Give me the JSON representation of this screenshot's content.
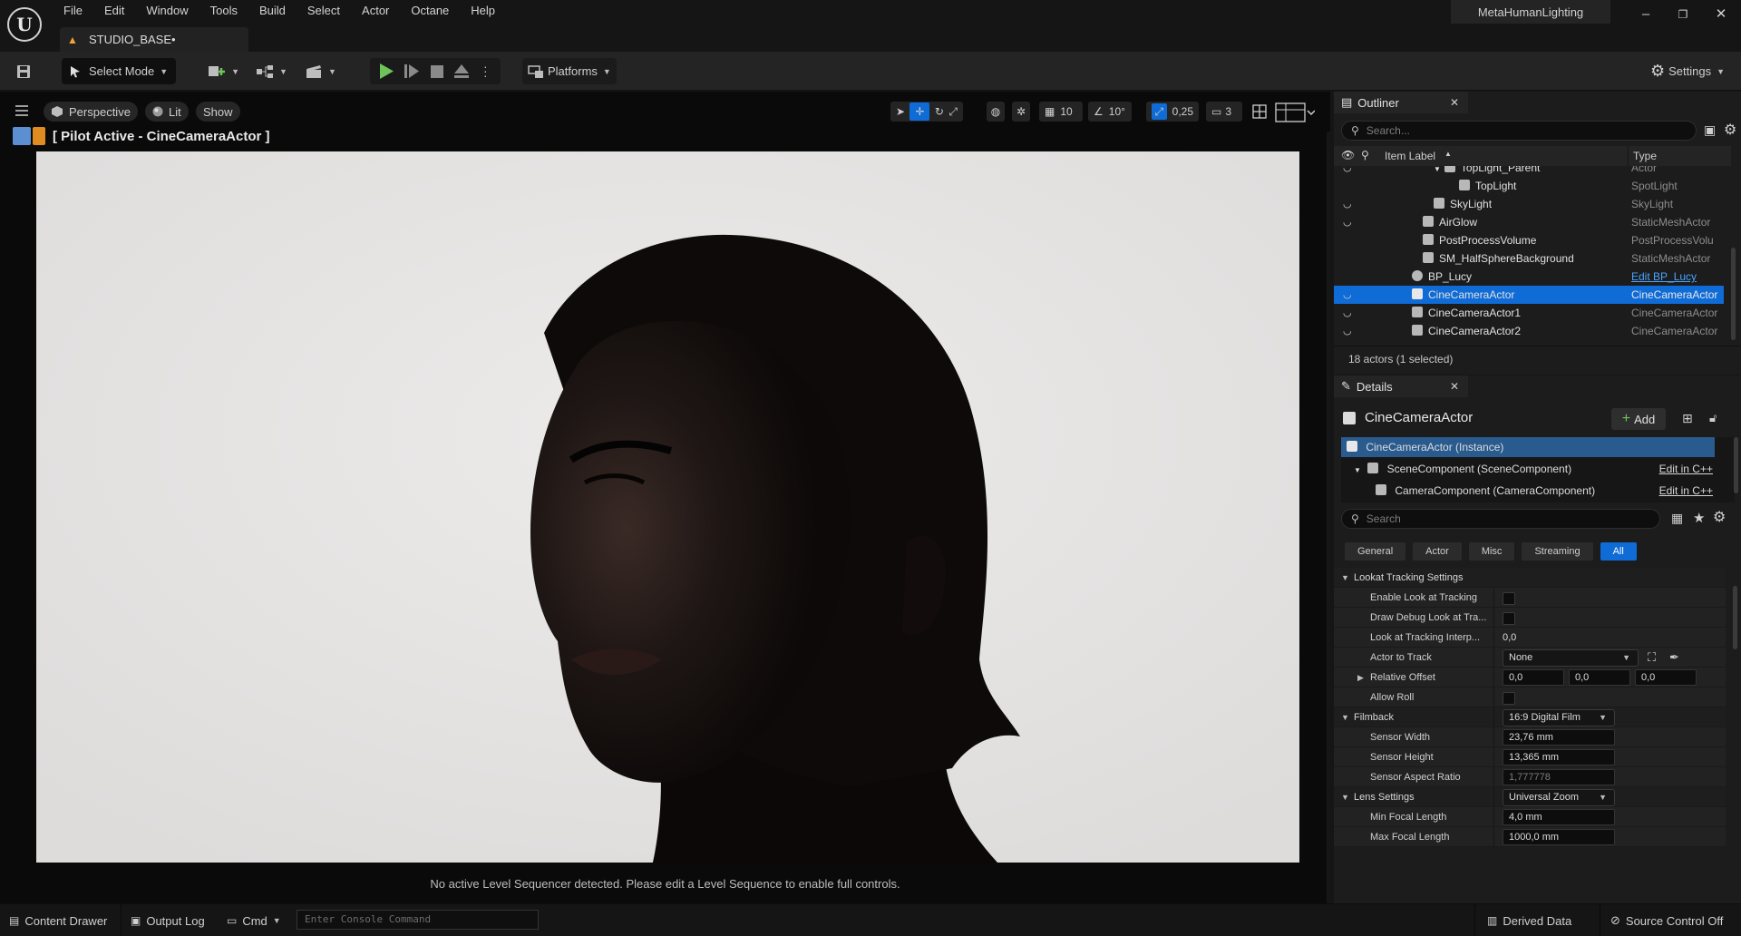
{
  "app": {
    "logo_label": "U",
    "menu": [
      "File",
      "Edit",
      "Window",
      "Tools",
      "Build",
      "Select",
      "Actor",
      "Octane",
      "Help"
    ],
    "document_tab": "STUDIO_BASE•",
    "project_name": "MetaHumanLighting",
    "window_controls": {
      "minimize": "–",
      "restore": "❐",
      "close": "✕"
    }
  },
  "toolbar": {
    "select_mode": "Select Mode",
    "platforms": "Platforms",
    "settings": "Settings"
  },
  "viewport": {
    "perspective": "Perspective",
    "lit": "Lit",
    "show": "Show",
    "grid_snap": "10",
    "rotation_snap": "10°",
    "scale_snap": "0,25",
    "camera_speed": "3",
    "pilot_label": "[ Pilot Active - CineCameraActor ]",
    "status_message": "No active Level Sequencer detected. Please edit a Level Sequence to enable full controls."
  },
  "outliner": {
    "tab_label": "Outliner",
    "search_placeholder": "Search...",
    "col_label": "Item Label",
    "col_type": "Type",
    "rows": [
      {
        "label": "TopLight_Parent",
        "type": "Actor"
      },
      {
        "label": "TopLight",
        "type": "SpotLight"
      },
      {
        "label": "SkyLight",
        "type": "SkyLight"
      },
      {
        "label": "AirGlow",
        "type": "StaticMeshActor"
      },
      {
        "label": "PostProcessVolume",
        "type": "PostProcessVolu"
      },
      {
        "label": "SM_HalfSphereBackground",
        "type": "StaticMeshActor"
      },
      {
        "label": "BP_Lucy",
        "type": "Edit BP_Lucy"
      },
      {
        "label": "CineCameraActor",
        "type": "CineCameraActor"
      },
      {
        "label": "CineCameraActor1",
        "type": "CineCameraActor"
      },
      {
        "label": "CineCameraActor2",
        "type": "CineCameraActor"
      }
    ],
    "actor_count": "18 actors (1 selected)"
  },
  "details": {
    "tab_label": "Details",
    "actor_name": "CineCameraActor",
    "add_label": "Add",
    "components": [
      {
        "label": "CineCameraActor (Instance)",
        "edit": ""
      },
      {
        "label": "SceneComponent (SceneComponent)",
        "edit": "Edit in C++"
      },
      {
        "label": "CameraComponent (CameraComponent)",
        "edit": "Edit in C++"
      }
    ],
    "search_placeholder": "Search",
    "filters": [
      "General",
      "Actor",
      "Misc",
      "Streaming",
      "All"
    ],
    "props": {
      "cat_lookat": "Lookat Tracking Settings",
      "enable_lookat": "Enable Look at Tracking",
      "draw_debug": "Draw Debug Look at Tra...",
      "lookat_interp": "Look at Tracking Interp...",
      "lookat_interp_val": "0,0",
      "actor_to_track": "Actor to Track",
      "actor_to_track_val": "None",
      "relative_offset": "Relative Offset",
      "offset_x": "0,0",
      "offset_y": "0,0",
      "offset_z": "0,0",
      "allow_roll": "Allow Roll",
      "cat_filmback": "Filmback",
      "filmback_val": "16:9 Digital Film",
      "sensor_width": "Sensor Width",
      "sensor_width_val": "23,76 mm",
      "sensor_height": "Sensor Height",
      "sensor_height_val": "13,365 mm",
      "sensor_ratio": "Sensor Aspect Ratio",
      "sensor_ratio_val": "1,777778",
      "cat_lens": "Lens Settings",
      "lens_val": "Universal Zoom",
      "min_focal": "Min Focal Length",
      "min_focal_val": "4,0 mm",
      "max_focal": "Max Focal Length",
      "max_focal_val": "1000,0 mm"
    }
  },
  "statusbar": {
    "content_drawer": "Content Drawer",
    "output_log": "Output Log",
    "cmd": "Cmd",
    "console_placeholder": "Enter Console Command",
    "derived_data": "Derived Data",
    "source_control": "Source Control Off"
  },
  "colors": {
    "accent": "#0f6bd6",
    "play_green": "#6ec45a",
    "warning_orange": "#f0a33a",
    "background_wall": "#e5e3e2"
  }
}
